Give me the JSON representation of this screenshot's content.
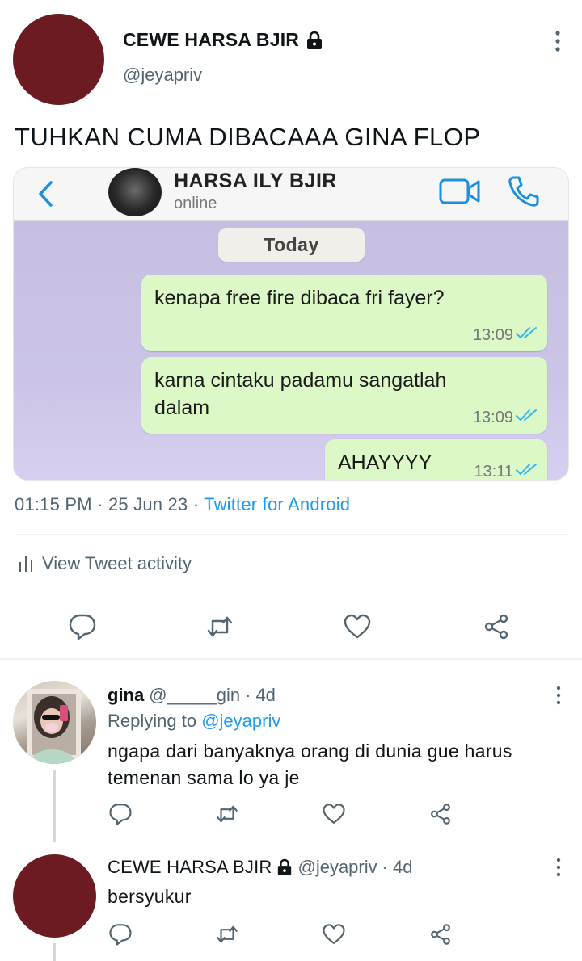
{
  "tweet": {
    "author_name": "CEWE HARSA BJIR",
    "author_handle": "@jeyapriv",
    "text": "TUHKAN CUMA DIBACAAA GINA FLOP",
    "timestamp": "01:15 PM",
    "separator": "·",
    "date": "25 Jun 23",
    "source": "Twitter for Android",
    "activity_label": "View Tweet activity",
    "avatar_color": "#6d1b22"
  },
  "chat_screenshot": {
    "contact_name": "HARSA ILY BJIR",
    "status": "online",
    "date_pill": "Today",
    "messages": [
      {
        "text_line1": "kenapa free fire dibaca fri fayer?",
        "text_line2": "",
        "time": "13:09"
      },
      {
        "text_line1": "karna cintaku padamu sangatlah",
        "text_line2": "dalam",
        "time": "13:09"
      },
      {
        "text_line1": "AHAYYYY",
        "text_line2": "",
        "time": "13:11"
      }
    ],
    "bubble_color": "#dcf8c6",
    "accent_color": "#1b8fe0"
  },
  "replies": [
    {
      "name": "gina",
      "handle": "@_____gin",
      "age": "4d",
      "replying_prefix": "Replying to",
      "replying_to": "@jeyapriv",
      "text_line1": "ngapa dari banyaknya orang di dunia gue harus",
      "text_line2": "temenan sama lo ya je"
    },
    {
      "name": "CEWE HARSA BJIR",
      "handle": "@jeyapriv",
      "age": "4d",
      "text_line1": "bersyukur"
    }
  ],
  "icons": {
    "lock": "lock-icon",
    "more": "more-vertical-icon",
    "reply": "reply-icon",
    "retweet": "retweet-icon",
    "like": "heart-icon",
    "share": "share-icon",
    "activity": "bar-chart-icon",
    "back": "chevron-left-icon",
    "video": "video-camera-icon",
    "call": "phone-icon",
    "read_ticks": "double-check-icon"
  },
  "colors": {
    "link": "#1d9bf0",
    "secondary_text": "#536471",
    "divider": "#eff3f4"
  }
}
